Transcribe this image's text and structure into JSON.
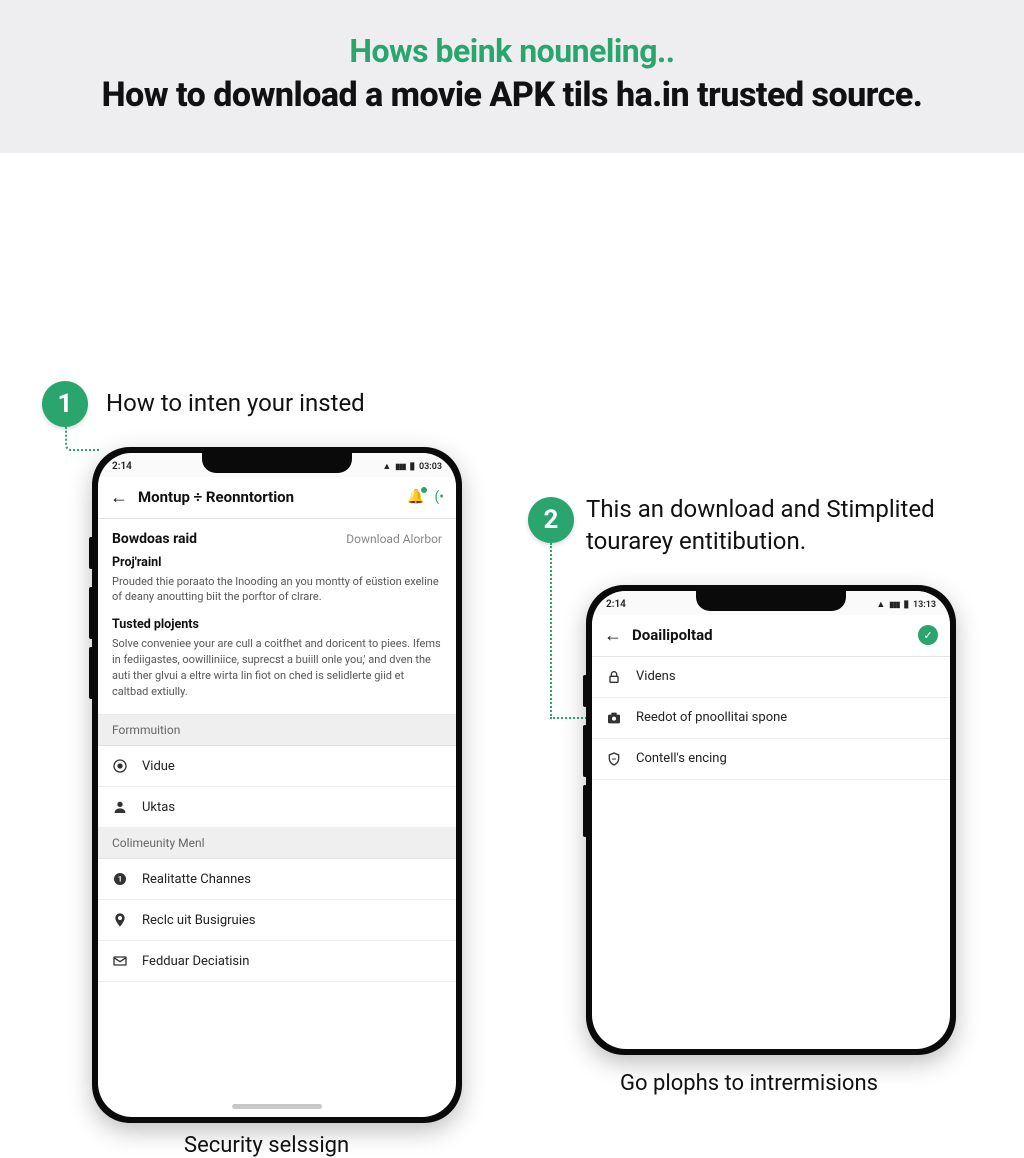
{
  "colors": {
    "accent": "#2aa56e"
  },
  "header": {
    "sub": "Hows beink nouneling..",
    "main": "How to download a movie APK tils ha.in trusted source."
  },
  "steps": {
    "s1": {
      "num": "1",
      "text": "How to inten your insted"
    },
    "s2": {
      "num": "2",
      "text": "This an download and Stimplited tourarey entitibution."
    }
  },
  "phone1": {
    "status": {
      "time": "2:14",
      "right": "03:03"
    },
    "appbar": {
      "title": "Montup ÷ Reonntortion"
    },
    "card1": {
      "title": "Bowdoas raid",
      "link": "Download Alorbor",
      "sub": "Proj'rainl",
      "body": "Prouded thie poraato the lnooding an you montty of eüstion exeline of deany anoutting biit the porftor of clrare."
    },
    "card2": {
      "sub": "Tusted plojents",
      "body": "Solve conveniee your are cull a coitfhet and doricent to piees. Ifems in fediigastes, oowilliniice, suprecst a buiill onle you,' and dven the auti ther glvui a eltre wirta lin fiot on ched is selidlerte giid et caltbad extiully."
    },
    "section1": {
      "title": "Formmuition",
      "rows": [
        {
          "icon": "target-icon",
          "label": "Vidue"
        },
        {
          "icon": "person-icon",
          "label": "Uktas"
        }
      ]
    },
    "section2": {
      "title": "Colimeunity Menl",
      "rows": [
        {
          "icon": "badge1-icon",
          "label": "Realitatte Channes"
        },
        {
          "icon": "pin-icon",
          "label": "Reclc uit Busigruies"
        },
        {
          "icon": "mail-icon",
          "label": "Fedduar Deciatisin"
        }
      ]
    },
    "caption": "Security selssign"
  },
  "phone2": {
    "status": {
      "time": "2:14",
      "right": "13:13"
    },
    "appbar": {
      "title": "Doailipoltad"
    },
    "rows": [
      {
        "icon": "lock-icon",
        "label": "Videns"
      },
      {
        "icon": "camera-icon",
        "label": "Reedot of pnoollitai spone"
      },
      {
        "icon": "shield-icon",
        "label": "Contell's encing"
      }
    ],
    "caption": "Go plophs to intrermisions"
  }
}
